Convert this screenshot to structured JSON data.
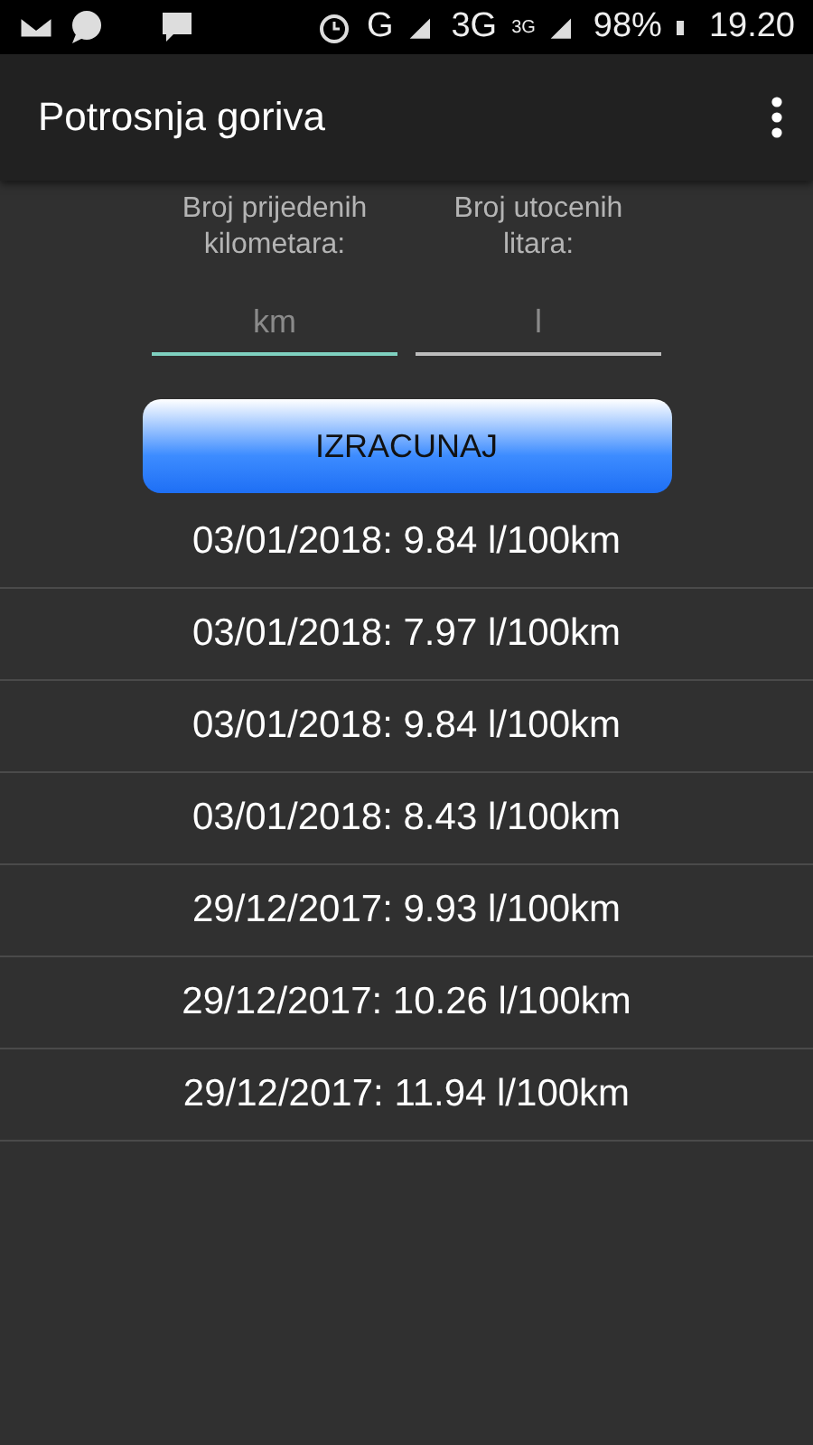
{
  "status_bar": {
    "network_1": "G",
    "network_2": "3G",
    "network_2_badge": "3G",
    "battery": "98%",
    "time": "19.20"
  },
  "app_bar": {
    "title": "Potrosnja goriva"
  },
  "inputs": [
    {
      "label": "Broj prijedenih kilometara:",
      "placeholder": "km",
      "focused": true
    },
    {
      "label": "Broj utocenih litara:",
      "placeholder": "l",
      "focused": false
    }
  ],
  "button": "IZRACUNAJ",
  "results": [
    "03/01/2018: 9.84 l/100km",
    "03/01/2018: 7.97 l/100km",
    "03/01/2018: 9.84 l/100km",
    "03/01/2018: 8.43 l/100km",
    "29/12/2017: 9.93 l/100km",
    "29/12/2017: 10.26 l/100km",
    "29/12/2017: 11.94 l/100km"
  ]
}
